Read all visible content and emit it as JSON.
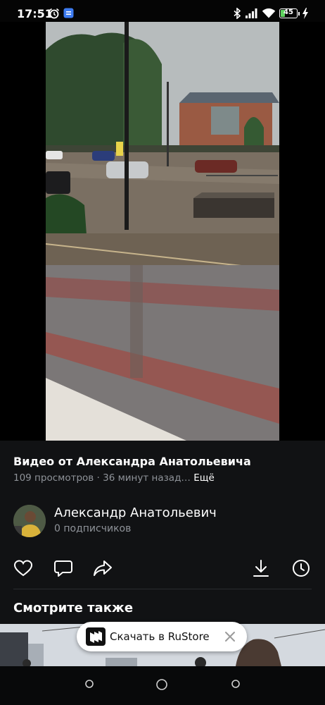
{
  "status_bar": {
    "time": "17:51",
    "battery_level": "45",
    "icons": [
      "alarm-icon",
      "app-notification-icon",
      "bluetooth-icon",
      "signal-icon",
      "wifi-icon",
      "battery-icon",
      "charging-icon"
    ]
  },
  "video": {
    "title": "Видео от Александра Анатольевича",
    "views": "109 просмотров",
    "separator": "·",
    "time_ago": "36 минут назад…",
    "more_label": "Ещё"
  },
  "author": {
    "name": "Александр Анатольевич",
    "subscribers": "0 подписчиков"
  },
  "actions": [
    "like-icon",
    "comment-icon",
    "share-icon",
    "download-icon",
    "watch-later-icon"
  ],
  "see_also": {
    "heading": "Смотрите также"
  },
  "rustore_banner": {
    "label": "Скачать в RuStore"
  },
  "colors": {
    "background": "#111214",
    "secondary_text": "#8f9399",
    "battery_green": "#5fd35f"
  }
}
